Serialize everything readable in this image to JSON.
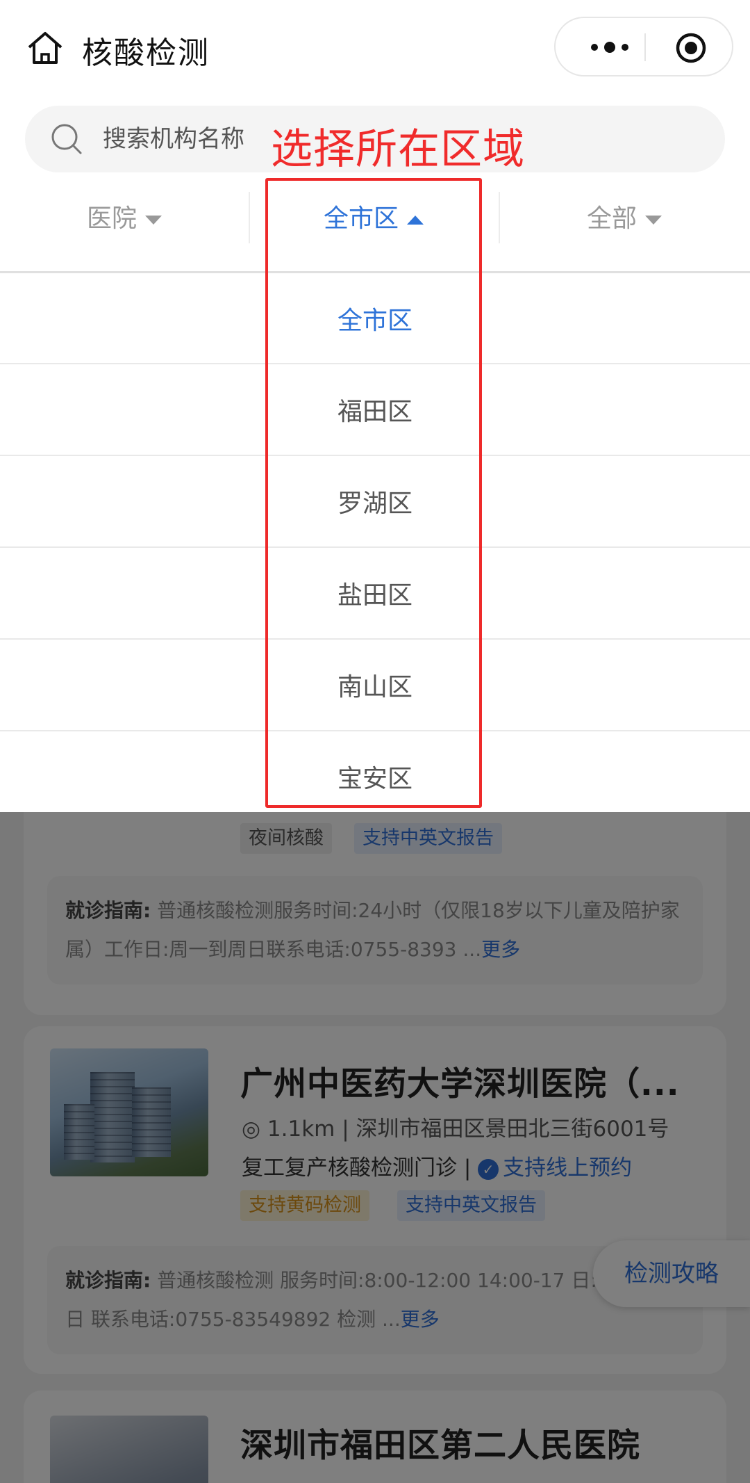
{
  "nav": {
    "title": "核酸检测",
    "home_icon": "home-icon",
    "more_icon": "more-dots-icon",
    "close_icon": "target-icon"
  },
  "search": {
    "placeholder": "搜索机构名称",
    "icon": "search-icon"
  },
  "annotation": {
    "text": "选择所在区域",
    "color": "#f02b2b"
  },
  "filters": [
    {
      "label": "医院",
      "state": "collapsed"
    },
    {
      "label": "全市区",
      "state": "expanded"
    },
    {
      "label": "全部",
      "state": "collapsed"
    }
  ],
  "district_options": [
    {
      "label": "全市区",
      "selected": true
    },
    {
      "label": "福田区",
      "selected": false
    },
    {
      "label": "罗湖区",
      "selected": false
    },
    {
      "label": "盐田区",
      "selected": false
    },
    {
      "label": "南山区",
      "selected": false
    },
    {
      "label": "宝安区",
      "selected": false
    }
  ],
  "cards": [
    {
      "tags": [
        "夜间核酸",
        "支持中英文报告"
      ],
      "guide_label": "就诊指南:",
      "guide_text": "普通核酸检测服务时间:24小时（仅限18岁以下儿童及陪护家属）工作日:周一到周日联系电话:0755-8393 ...",
      "guide_more": "更多"
    },
    {
      "title": "广州中医药大学深圳医院（...",
      "location": "1.1km | 深圳市福田区景田北三街6001号",
      "service": "复工复产核酸检测门诊 |",
      "booking": "支持线上预约",
      "tags": [
        "支持黄码检测",
        "支持中英文报告"
      ],
      "guide_label": "就诊指南:",
      "guide_text": "普通核酸检测 服务时间:8:00-12:00 14:00-17 日:周一到周日 联系电话:0755-83549892 检测 ...",
      "guide_more": "更多"
    },
    {
      "title": "深圳市福田区第二人民医院"
    }
  ],
  "float_button": {
    "label": "检测攻略"
  },
  "colors": {
    "accent": "#2e73d8",
    "annotation": "#f02b2b",
    "muted": "#999999"
  }
}
